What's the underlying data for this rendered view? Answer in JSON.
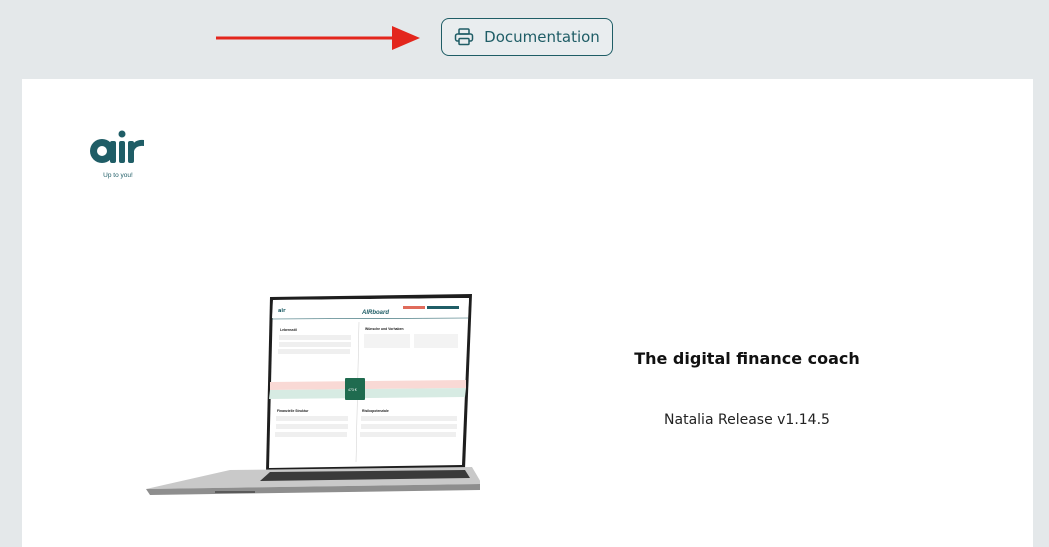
{
  "toolbar": {
    "documentation_label": "Documentation",
    "icons": {
      "documentation": "printer-icon",
      "pointer": "red-arrow"
    },
    "colors": {
      "accent": "#1f5d66",
      "arrow": "#e3261d"
    }
  },
  "logo": {
    "text": "air",
    "tagline": "Up to you!"
  },
  "hero": {
    "headline": "The digital finance coach",
    "release": "Natalia Release v1.14.5"
  },
  "laptop_screen": {
    "app_title": "AIRboard",
    "panel_top_left": "Lebensstil",
    "panel_top_right": "Wünsche und Vorhaben",
    "panel_bottom_left": "Finanzielle Struktur",
    "panel_bottom_right": "Risikopotenziale",
    "center_value": "473 €"
  }
}
